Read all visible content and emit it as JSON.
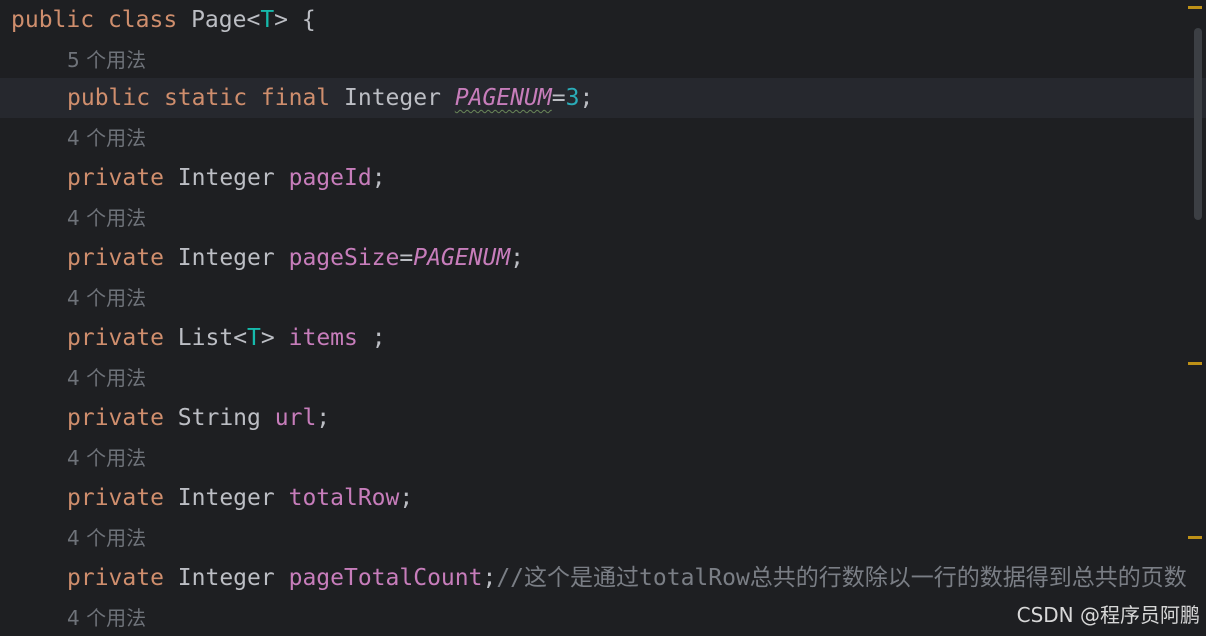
{
  "colors": {
    "background": "#1e1f22",
    "current_line": "#26282e",
    "keyword": "#cf8e6d",
    "type_param": "#16baac",
    "field": "#c77dbb",
    "number": "#2aacb8",
    "hint": "#6f737a",
    "marker": "#be9117"
  },
  "class_decl": {
    "kw_public": "public",
    "kw_class": "class",
    "name": "Page",
    "lt": "<",
    "type_param": "T",
    "gt_brace": "> {"
  },
  "hints": {
    "h1": "5 个用法",
    "h2": "4 个用法",
    "h3": "4 个用法",
    "h4": "4 个用法",
    "h5": "4 个用法",
    "h6": "4 个用法",
    "h7": "4 个用法",
    "h8": "4 个用法"
  },
  "line_pagenum": {
    "kw1": "public",
    "kw2": "static",
    "kw3": "final",
    "type": "Integer",
    "name": "PAGENUM",
    "eq": "=",
    "value": "3",
    "semi": ";"
  },
  "line_pageid": {
    "kw": "private",
    "type": "Integer",
    "name": "pageId",
    "semi": ";"
  },
  "line_pagesize": {
    "kw": "private",
    "type": "Integer",
    "name": "pageSize",
    "eq": "=",
    "value": "PAGENUM",
    "semi": ";"
  },
  "line_items": {
    "kw": "private",
    "type": "List",
    "lt": "<",
    "type_param": "T",
    "gt": ">",
    "name": "items",
    "semi": " ;"
  },
  "line_url": {
    "kw": "private",
    "type": "String",
    "name": "url",
    "semi": ";"
  },
  "line_totalrow": {
    "kw": "private",
    "type": "Integer",
    "name": "totalRow",
    "semi": ";"
  },
  "line_pagetotalcount": {
    "kw": "private",
    "type": "Integer",
    "name": "pageTotalCount",
    "semi": ";",
    "comment": "//这个是通过totalRow总共的行数除以一行的数据得到总共的页数"
  },
  "watermark": "CSDN @程序员阿鹏"
}
